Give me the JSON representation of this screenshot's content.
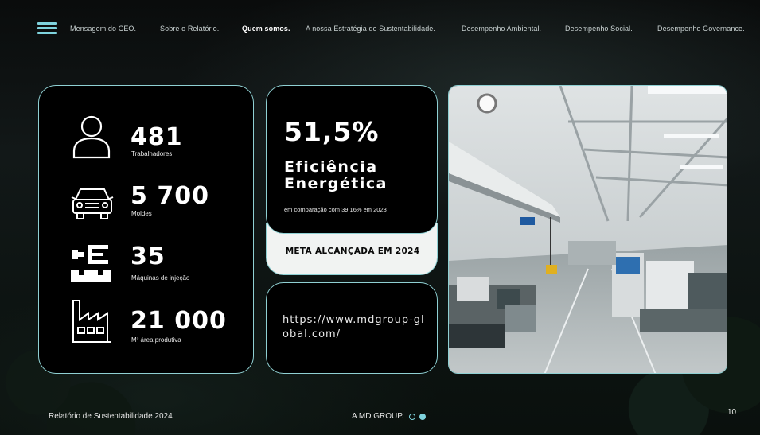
{
  "nav": {
    "menu_icon": "hamburger-menu-icon",
    "items": [
      {
        "label": "Mensagem do CEO."
      },
      {
        "label": "Sobre o Relatório."
      },
      {
        "label": "Quem somos.",
        "active": true
      },
      {
        "label": "A nossa Estratégia de Sustentabilidade."
      },
      {
        "label": "Desempenho Ambiental."
      },
      {
        "label": "Desempenho Social."
      },
      {
        "label": "Desempenho Governance."
      }
    ]
  },
  "stats": [
    {
      "icon": "person-icon",
      "value": "481",
      "label": "Trabalhadores"
    },
    {
      "icon": "car-icon",
      "value": "5 700",
      "label": "Moldes"
    },
    {
      "icon": "injection-machine-icon",
      "value": "35",
      "label": "Máquinas de injeção"
    },
    {
      "icon": "factory-icon",
      "value": "21 000",
      "label": "M² área produtiva"
    }
  ],
  "efficiency": {
    "value": "51,5%",
    "title": "Eficiência Energética",
    "comparison": "em comparação com 39,16% em 2023",
    "goal": "META ALCANÇADA EM 2024"
  },
  "link": {
    "url": "https://www.mdgroup-global.com/"
  },
  "footer": {
    "report": "Relatório de Sustentabilidade 2024",
    "section": "A MD GROUP.",
    "page": "10"
  },
  "colors": {
    "accent": "#7fd3dd",
    "border": "#8fd0d3",
    "card": "#000000",
    "goal_bg": "#f1f3f2"
  }
}
